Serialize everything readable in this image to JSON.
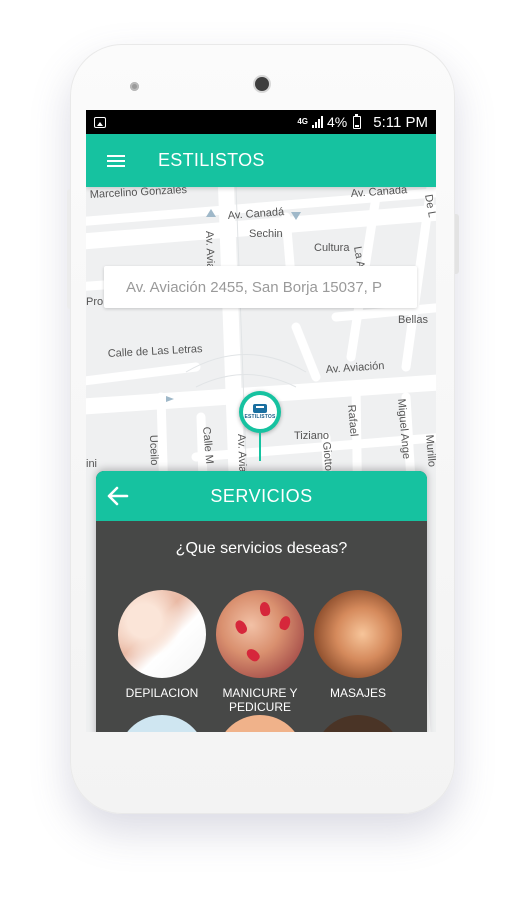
{
  "statusbar": {
    "network": "4G",
    "battery": "4%",
    "time": "5:11 PM"
  },
  "app": {
    "title": "ESTILISTOS"
  },
  "map": {
    "streets": [
      "Marcelino Gonzales",
      "Av. Canadá",
      "Av. Canadá",
      "Sechin",
      "Cultura",
      "La Arqueol",
      "De L",
      "Av. Aviación",
      "Pro",
      "Bellas",
      "Calle de Las Letras",
      "Av. Aviación",
      "Tiziano",
      "Rafael",
      "Miguel Ange",
      "Murillo",
      "Uceilo",
      "Calle M",
      "Giotto",
      "ini"
    ]
  },
  "search": {
    "value": "Av. Aviación 2455, San Borja 15037, P"
  },
  "pin": {
    "brand": "ESTILISTOS"
  },
  "panel": {
    "title": "SERVICIOS",
    "question": "¿Que servicios deseas?",
    "services": [
      {
        "label": "DEPILACION"
      },
      {
        "label": "MANICURE Y PEDICURE"
      },
      {
        "label": "MASAJES"
      }
    ]
  },
  "colors": {
    "accent": "#16c2a0",
    "panel": "#474847"
  },
  "icons": [
    "menu-icon",
    "back-arrow-icon",
    "gallery-icon",
    "signal-icon",
    "battery-icon"
  ]
}
